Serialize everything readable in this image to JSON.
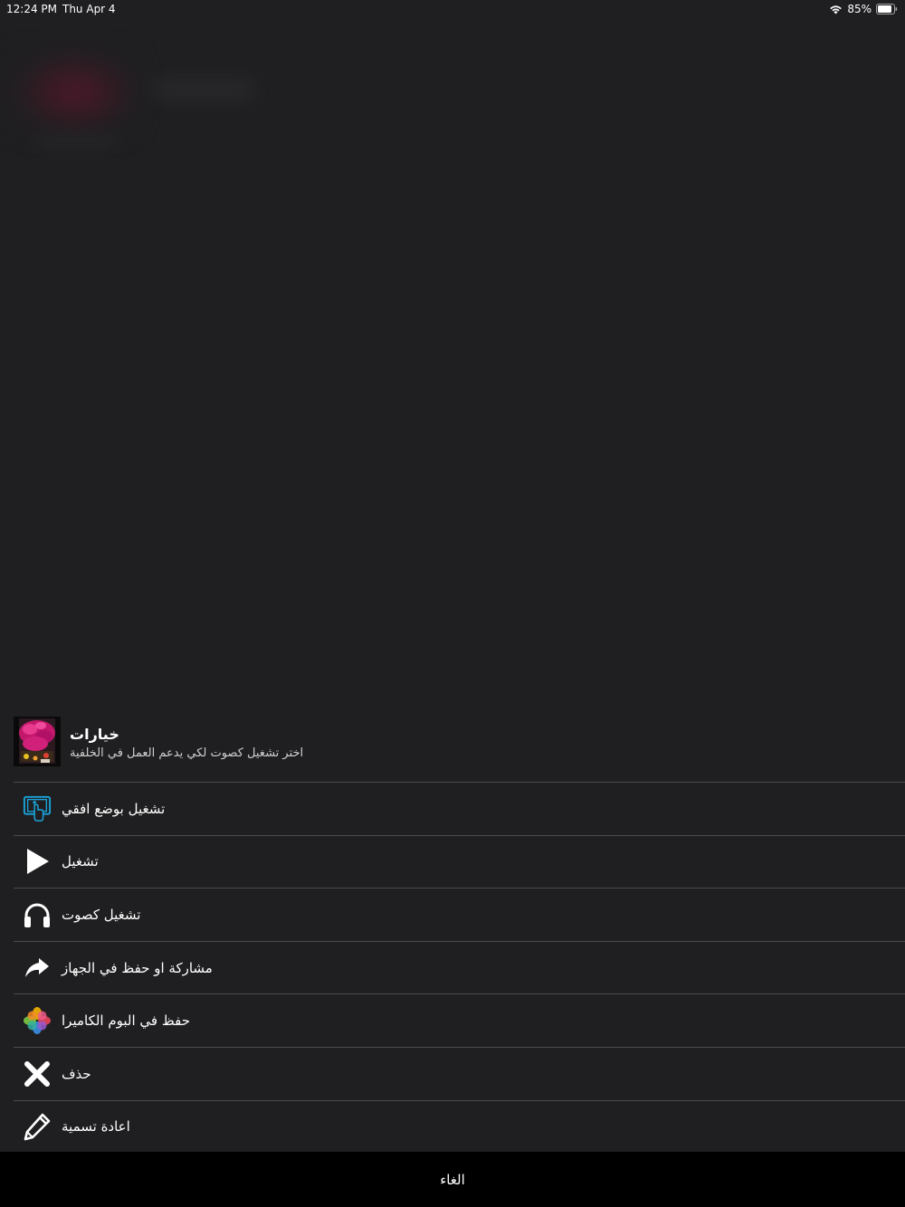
{
  "status_bar": {
    "time": "12:24 PM",
    "date": "Thu Apr 4",
    "battery": "85%"
  },
  "sheet": {
    "title": "خيارات",
    "subtitle": "اختر تشغيل كصوت لكي يدعم العمل في الخلفية",
    "options": [
      {
        "label": "تشغيل بوضع افقي",
        "icon": "landscape-rotate-icon"
      },
      {
        "label": "تشغيل",
        "icon": "play-icon"
      },
      {
        "label": "تشغيل كصوت",
        "icon": "headphones-icon"
      },
      {
        "label": "مشاركة او حفظ في الجهاز",
        "icon": "share-arrow-icon"
      },
      {
        "label": "حفظ في البوم الكاميرا",
        "icon": "photos-icon"
      },
      {
        "label": "حذف",
        "icon": "close-icon"
      },
      {
        "label": "اعادة تسمية",
        "icon": "pencil-icon"
      }
    ],
    "cancel_label": "الغاء"
  },
  "colors": {
    "background": "#1f1f21",
    "separator": "#4a4a4d",
    "cancel_background": "#000000",
    "landscape_icon_accent": "#1aa3d9"
  }
}
